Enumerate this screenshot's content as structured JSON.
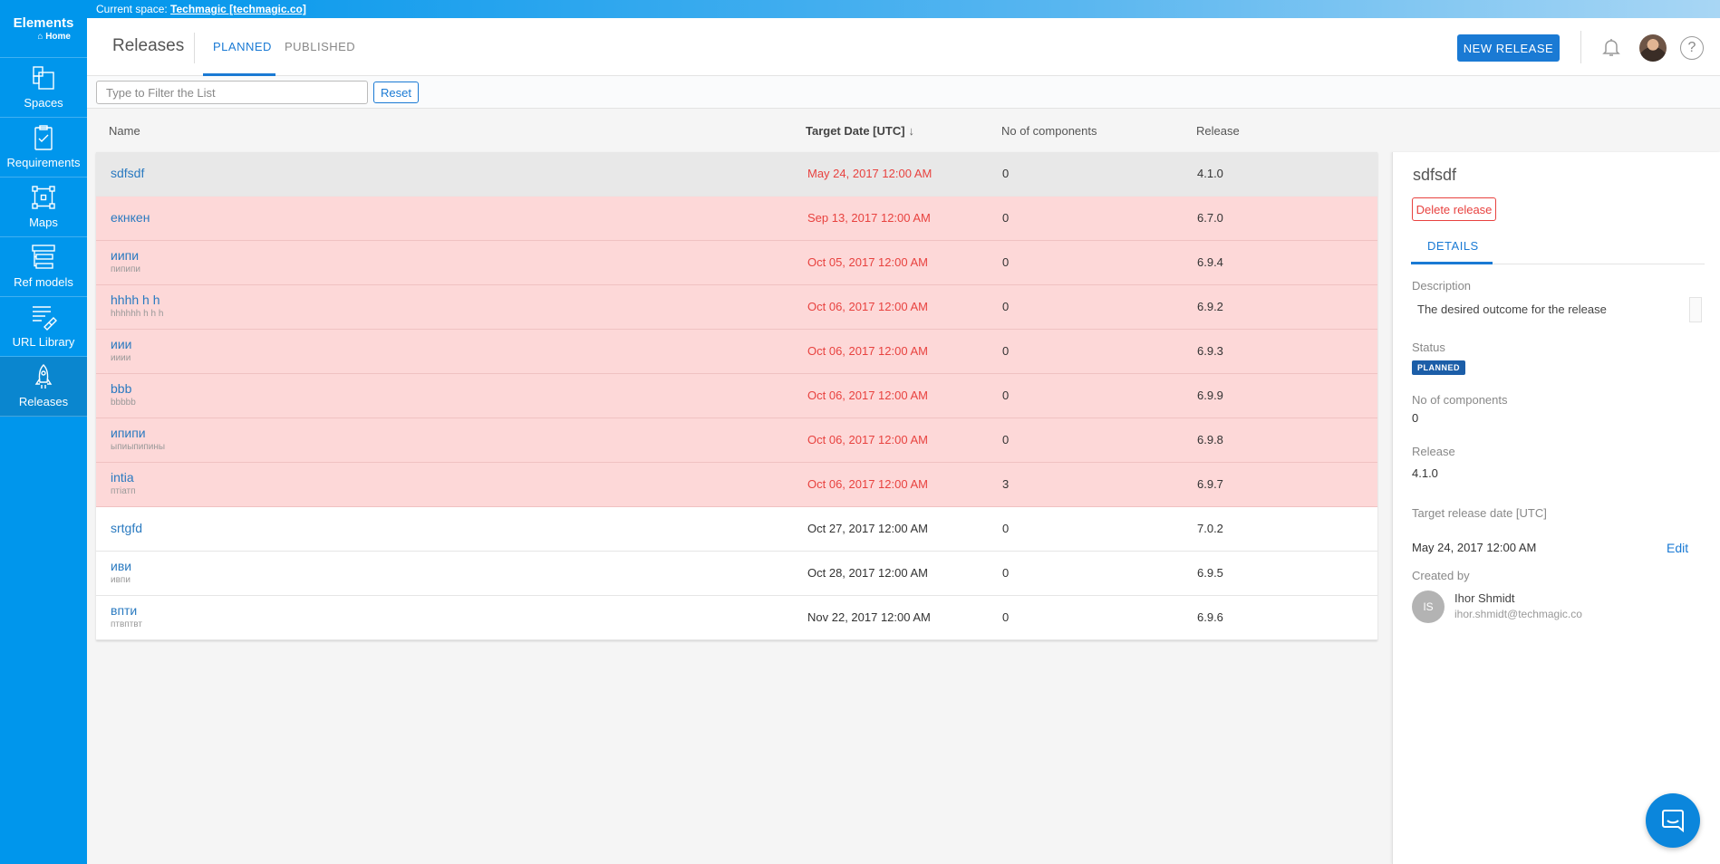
{
  "sidebar": {
    "brand": "Elements",
    "home_label": "Home",
    "items": [
      {
        "label": "Spaces"
      },
      {
        "label": "Requirements"
      },
      {
        "label": "Maps"
      },
      {
        "label": "Ref models"
      },
      {
        "label": "URL Library"
      },
      {
        "label": "Releases",
        "active": true
      }
    ]
  },
  "topbar": {
    "prefix": "Current space:",
    "space_link": "Techmagic [techmagic.co]"
  },
  "header": {
    "title": "Releases",
    "tabs": [
      "PLANNED",
      "PUBLISHED"
    ],
    "active_tab": "PLANNED",
    "new_release_label": "NEW RELEASE",
    "help_glyph": "?"
  },
  "filter": {
    "placeholder": "Type to Filter the List",
    "value": "",
    "reset_label": "Reset"
  },
  "table": {
    "columns": [
      "Name",
      "Target Date [UTC]",
      "No of components",
      "Release"
    ],
    "sort_arrow": "↓",
    "rows": [
      {
        "name": "sdfsdf",
        "subtitle": "",
        "date": "May 24, 2017 12:00 AM",
        "components": "0",
        "release": "4.1.0",
        "state": "selected"
      },
      {
        "name": "екнкен",
        "subtitle": "",
        "date": "Sep 13, 2017 12:00 AM",
        "components": "0",
        "release": "6.7.0",
        "state": "overdue"
      },
      {
        "name": "иипи",
        "subtitle": "пипипи",
        "date": "Oct 05, 2017 12:00 AM",
        "components": "0",
        "release": "6.9.4",
        "state": "overdue"
      },
      {
        "name": "hhhh h h",
        "subtitle": "hhhhhh h h h",
        "date": "Oct 06, 2017 12:00 AM",
        "components": "0",
        "release": "6.9.2",
        "state": "overdue"
      },
      {
        "name": "иии",
        "subtitle": "ииии",
        "date": "Oct 06, 2017 12:00 AM",
        "components": "0",
        "release": "6.9.3",
        "state": "overdue"
      },
      {
        "name": "bbb",
        "subtitle": "bbbbb",
        "date": "Oct 06, 2017 12:00 AM",
        "components": "0",
        "release": "6.9.9",
        "state": "overdue"
      },
      {
        "name": "ипипи",
        "subtitle": "ыпиыпипины",
        "date": "Oct 06, 2017 12:00 AM",
        "components": "0",
        "release": "6.9.8",
        "state": "overdue"
      },
      {
        "name": "intia",
        "subtitle": "птiатп",
        "date": "Oct 06, 2017 12:00 AM",
        "components": "3",
        "release": "6.9.7",
        "state": "overdue"
      },
      {
        "name": "srtgfd",
        "subtitle": "",
        "date": "Oct 27, 2017 12:00 AM",
        "components": "0",
        "release": "7.0.2",
        "state": "normal"
      },
      {
        "name": "иви",
        "subtitle": "ивпи",
        "date": "Oct 28, 2017 12:00 AM",
        "components": "0",
        "release": "6.9.5",
        "state": "normal"
      },
      {
        "name": "впти",
        "subtitle": "птвптвт",
        "date": "Nov 22, 2017 12:00 AM",
        "components": "0",
        "release": "6.9.6",
        "state": "normal"
      }
    ]
  },
  "detail": {
    "title": "sdfsdf",
    "delete_label": "Delete release",
    "tab": "DETAILS",
    "description_label": "Description",
    "description_value": "The desired outcome for the release",
    "status_label": "Status",
    "status_value": "PLANNED",
    "components_label": "No of components",
    "components_value": "0",
    "release_label": "Release",
    "release_value": "4.1.0",
    "target_label": "Target release date [UTC]",
    "target_value": "May 24, 2017 12:00 AM",
    "edit_label": "Edit",
    "created_by_label": "Created by",
    "creator_initials": "IS",
    "creator_name": "Ihor Shmidt",
    "creator_email": "ihor.shmidt@techmagic.co"
  },
  "colors": {
    "sidebar": "#0096ec",
    "accent": "#1a7ad4",
    "overdue_bg": "#fdd8d8",
    "overdue_text": "#e8423f",
    "status_badge": "#1c5ea8"
  },
  "icons": [
    "spaces-icon",
    "requirements-icon",
    "maps-icon",
    "ref-models-icon",
    "url-library-icon",
    "releases-icon",
    "bell-icon",
    "help-icon",
    "chat-icon"
  ]
}
